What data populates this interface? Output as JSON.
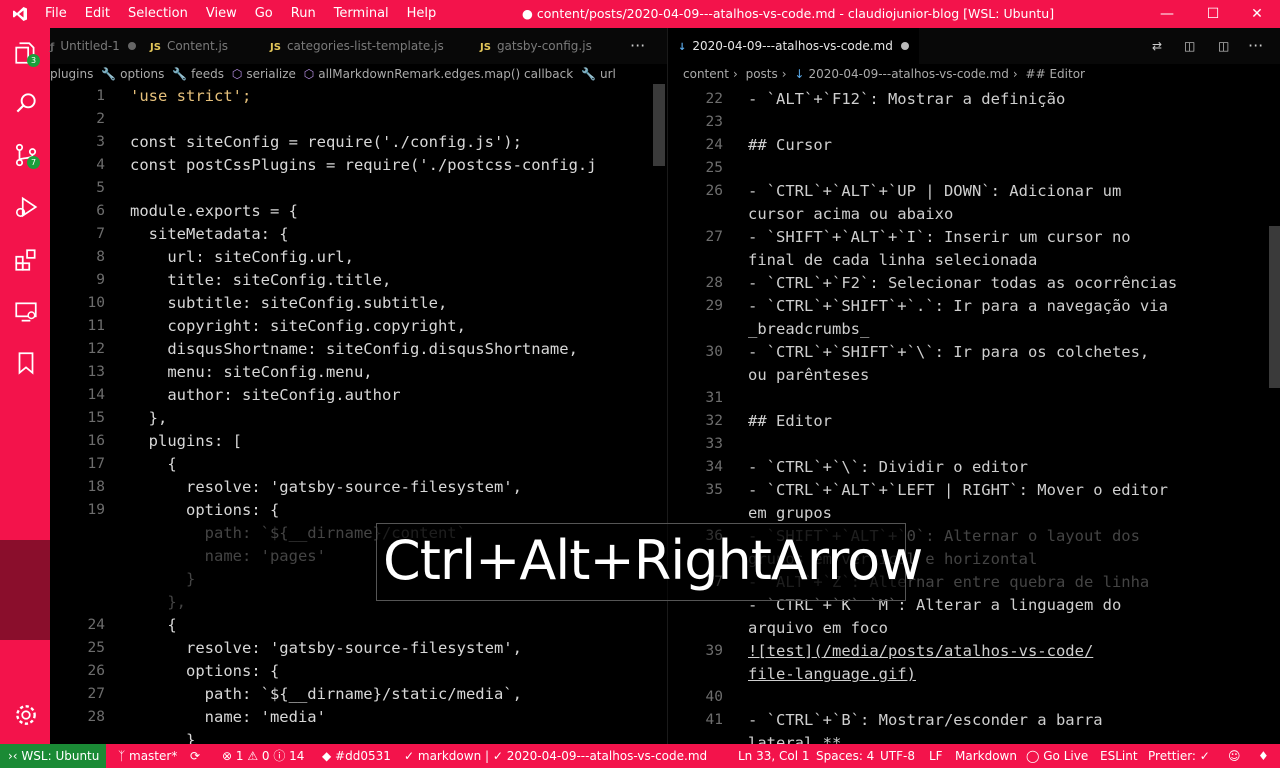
{
  "titlebar": {
    "menu": [
      "File",
      "Edit",
      "Selection",
      "View",
      "Go",
      "Run",
      "Terminal",
      "Help"
    ],
    "title": "● content/posts/2020-04-09---atalhos-vs-code.md - claudiojunior-blog [WSL: Ubuntu]"
  },
  "activity": {
    "explorer_badge": "3",
    "scm_badge": "7"
  },
  "left_tabs": [
    {
      "label": "Untitled-1"
    },
    {
      "label": "Content.js"
    },
    {
      "label": "categories-list-template.js"
    },
    {
      "label": "gatsby-config.js"
    }
  ],
  "left_crumbs": [
    "plugins",
    "options",
    "feeds",
    "serialize",
    "allMarkdownRemark.edges.map() callback",
    "url"
  ],
  "right_tab": {
    "label": "2020-04-09---atalhos-vs-code.md"
  },
  "right_crumbs": [
    "content",
    "posts",
    "2020-04-09---atalhos-vs-code.md",
    "## Editor"
  ],
  "left_code": [
    {
      "n": "1",
      "t": "'use strict';"
    },
    {
      "n": "2",
      "t": ""
    },
    {
      "n": "3",
      "t": "const siteConfig = require('./config.js');"
    },
    {
      "n": "4",
      "t": "const postCssPlugins = require('./postcss-config.j"
    },
    {
      "n": "5",
      "t": ""
    },
    {
      "n": "6",
      "t": "module.exports = {"
    },
    {
      "n": "7",
      "t": "  siteMetadata: {"
    },
    {
      "n": "8",
      "t": "    url: siteConfig.url,"
    },
    {
      "n": "9",
      "t": "    title: siteConfig.title,"
    },
    {
      "n": "10",
      "t": "    subtitle: siteConfig.subtitle,"
    },
    {
      "n": "11",
      "t": "    copyright: siteConfig.copyright,"
    },
    {
      "n": "12",
      "t": "    disqusShortname: siteConfig.disqusShortname,"
    },
    {
      "n": "13",
      "t": "    menu: siteConfig.menu,"
    },
    {
      "n": "14",
      "t": "    author: siteConfig.author"
    },
    {
      "n": "15",
      "t": "  },"
    },
    {
      "n": "16",
      "t": "  plugins: ["
    },
    {
      "n": "17",
      "t": "    {"
    },
    {
      "n": "18",
      "t": "      resolve: 'gatsby-source-filesystem',"
    },
    {
      "n": "19",
      "t": "      options: {"
    },
    {
      "n": "",
      "t": "        path: `${__dirname}/content`,"
    },
    {
      "n": "",
      "t": "        name: 'pages'"
    },
    {
      "n": "",
      "t": "      }"
    },
    {
      "n": "",
      "t": "    },"
    },
    {
      "n": "24",
      "t": "    {"
    },
    {
      "n": "25",
      "t": "      resolve: 'gatsby-source-filesystem',"
    },
    {
      "n": "26",
      "t": "      options: {"
    },
    {
      "n": "27",
      "t": "        path: `${__dirname}/static/media`,"
    },
    {
      "n": "28",
      "t": "        name: 'media'"
    },
    {
      "n": "",
      "t": "      }"
    }
  ],
  "right_code": [
    {
      "n": "22",
      "t": "- `ALT`+`F12`: Mostrar a definição"
    },
    {
      "n": "23",
      "t": ""
    },
    {
      "n": "24",
      "t": "## Cursor"
    },
    {
      "n": "25",
      "t": ""
    },
    {
      "n": "26",
      "t": "- `CTRL`+`ALT`+`UP | DOWN`: Adicionar um"
    },
    {
      "n": "",
      "t": "cursor acima ou abaixo"
    },
    {
      "n": "27",
      "t": "- `SHIFT`+`ALT`+`I`: Inserir um cursor no"
    },
    {
      "n": "",
      "t": "final de cada linha selecionada"
    },
    {
      "n": "28",
      "t": "- `CTRL`+`F2`: Selecionar todas as ocorrências"
    },
    {
      "n": "29",
      "t": "- `CTRL`+`SHIFT`+`.`: Ir para a navegação via"
    },
    {
      "n": "",
      "t": "_breadcrumbs_"
    },
    {
      "n": "30",
      "t": "- `CTRL`+`SHIFT`+`\\`: Ir para os colchetes,"
    },
    {
      "n": "",
      "t": "ou parênteses"
    },
    {
      "n": "31",
      "t": ""
    },
    {
      "n": "32",
      "t": "## Editor"
    },
    {
      "n": "33",
      "t": ""
    },
    {
      "n": "34",
      "t": "- `CTRL`+`\\`: Dividir o editor"
    },
    {
      "n": "35",
      "t": "- `CTRL`+`ALT`+`LEFT | RIGHT`: Mover o editor"
    },
    {
      "n": "",
      "t": "em grupos"
    },
    {
      "n": "36",
      "t": "- `SHIFT`+`ALT`+`0`: Alternar o layout dos"
    },
    {
      "n": "",
      "t": "grupos em vertical e horizontal"
    },
    {
      "n": "37",
      "t": "- `ALT`+`Z`: Alternar entre quebra de linha"
    },
    {
      "n": "",
      "t": "- `CTRL`+`K` `M`: Alterar a linguagem do"
    },
    {
      "n": "",
      "t": "arquivo em foco"
    },
    {
      "n": "39",
      "t": "![test](/media/posts/atalhos-vs-code/"
    },
    {
      "n": "",
      "t": "file-language.gif)"
    },
    {
      "n": "40",
      "t": ""
    },
    {
      "n": "41",
      "t": "- `CTRL`+`B`: Mostrar/esconder a barra"
    },
    {
      "n": "",
      "t": "lateral **"
    }
  ],
  "overlay": {
    "text": "Ctrl+Alt+RightArrow"
  },
  "status": {
    "wsl": "WSL: Ubuntu",
    "branch": "master*",
    "problems": "⊗ 1 ⚠ 0 ⓘ 14",
    "color": "#dd0531",
    "lang_crumb": "markdown | ✓ 2020-04-09---atalhos-vs-code.md",
    "position": "Ln 33, Col 1",
    "spaces": "Spaces: 4",
    "encoding": "UTF-8",
    "eol": "LF",
    "language": "Markdown",
    "golive": "Go Live",
    "eslint": "ESLint",
    "prettier": "Prettier: ✓"
  },
  "colors": {
    "accent": "#f3134b",
    "wsl": "#1a8a35",
    "badge": "#1c9e3b"
  }
}
